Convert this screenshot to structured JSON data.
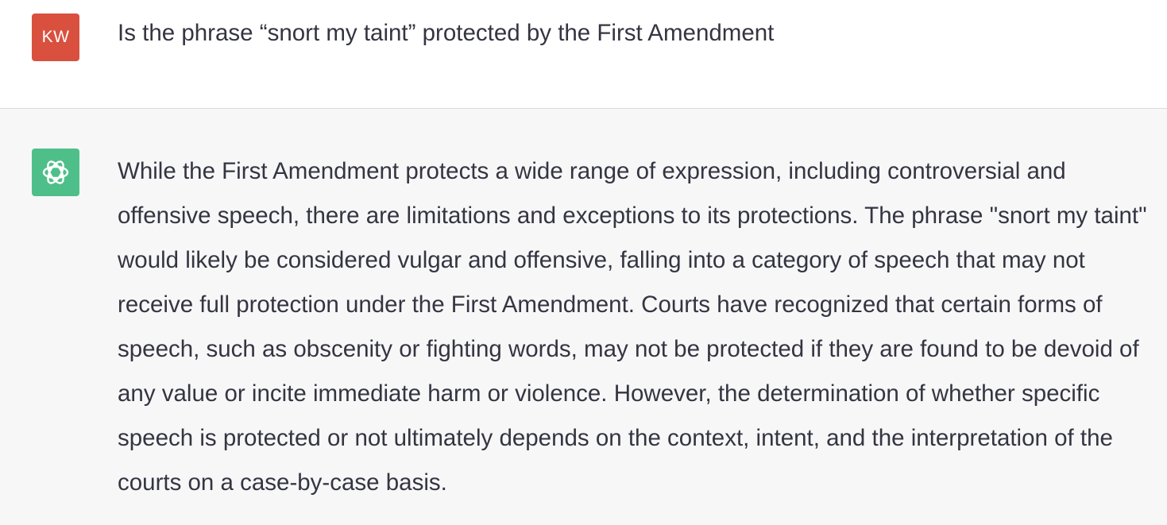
{
  "colors": {
    "user_avatar_bg": "#d9503f",
    "assistant_avatar_bg": "#4fbf89",
    "text": "#343541",
    "assistant_row_bg": "#f7f7f8"
  },
  "user_message": {
    "avatar_initials": "KW",
    "text": "Is the phrase “snort my taint” protected by the First Amendment"
  },
  "assistant_message": {
    "avatar_icon": "openai-logo-icon",
    "text": "While the First Amendment protects a wide range of expression, including controversial and offensive speech, there are limitations and exceptions to its protections. The phrase \"snort my taint\" would likely be considered vulgar and offensive, falling into a category of speech that may not receive full protection under the First Amendment. Courts have recognized that certain forms of speech, such as obscenity or fighting words, may not be protected if they are found to be devoid of any value or incite immediate harm or violence. However, the determination of whether specific speech is protected or not ultimately depends on the context, intent, and the interpretation of the courts on a case-by-case basis."
  }
}
